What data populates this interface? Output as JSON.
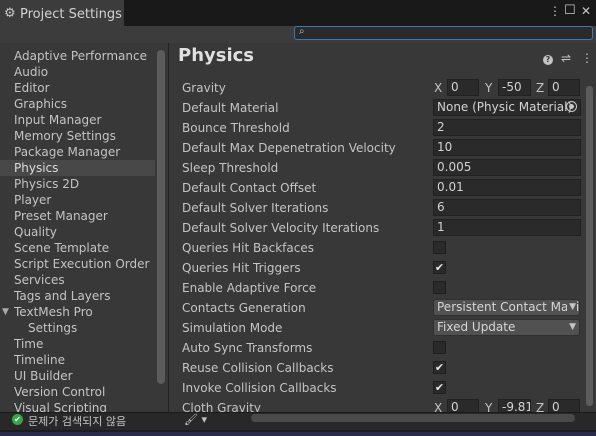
{
  "window": {
    "tab_title": "Project Settings",
    "tab_icon": "gear-icon",
    "menu_glyph": "⋮",
    "maximize_glyph": "☐",
    "close_glyph": "✕"
  },
  "search": {
    "value": "",
    "icon_glyph": "🔍"
  },
  "sidebar": {
    "items": [
      {
        "label": "Adaptive Performance"
      },
      {
        "label": "Audio"
      },
      {
        "label": "Editor"
      },
      {
        "label": "Graphics"
      },
      {
        "label": "Input Manager"
      },
      {
        "label": "Memory Settings"
      },
      {
        "label": "Package Manager"
      },
      {
        "label": "Physics",
        "selected": true
      },
      {
        "label": "Physics 2D"
      },
      {
        "label": "Player"
      },
      {
        "label": "Preset Manager"
      },
      {
        "label": "Quality"
      },
      {
        "label": "Scene Template"
      },
      {
        "label": "Script Execution Order"
      },
      {
        "label": "Services"
      },
      {
        "label": "Tags and Layers"
      },
      {
        "label": "TextMesh Pro",
        "expanded": true
      },
      {
        "label": "Settings",
        "child": true
      },
      {
        "label": "Time"
      },
      {
        "label": "Timeline"
      },
      {
        "label": "UI Builder"
      },
      {
        "label": "Version Control"
      },
      {
        "label": "Visual Scripting"
      }
    ]
  },
  "header": {
    "title": "Physics",
    "help_glyph": "?",
    "preset_glyph": "⇌",
    "menu_glyph": "⋮"
  },
  "properties": {
    "gravity": {
      "label": "Gravity",
      "x_label": "X",
      "x": "0",
      "y_label": "Y",
      "y": "-50",
      "z_label": "Z",
      "z": "0"
    },
    "default_material": {
      "label": "Default Material",
      "value": "None (Physic Material)"
    },
    "bounce_threshold": {
      "label": "Bounce Threshold",
      "value": "2"
    },
    "max_depenetration": {
      "label": "Default Max Depenetration Velocity",
      "value": "10"
    },
    "sleep_threshold": {
      "label": "Sleep Threshold",
      "value": "0.005"
    },
    "contact_offset": {
      "label": "Default Contact Offset",
      "value": "0.01"
    },
    "solver_iterations": {
      "label": "Default Solver Iterations",
      "value": "6"
    },
    "solver_velocity_iterations": {
      "label": "Default Solver Velocity Iterations",
      "value": "1"
    },
    "queries_hit_backfaces": {
      "label": "Queries Hit Backfaces",
      "checked": false
    },
    "queries_hit_triggers": {
      "label": "Queries Hit Triggers",
      "checked": true
    },
    "enable_adaptive_force": {
      "label": "Enable Adaptive Force",
      "checked": false
    },
    "contacts_generation": {
      "label": "Contacts Generation",
      "value": "Persistent Contact Manifold"
    },
    "simulation_mode": {
      "label": "Simulation Mode",
      "value": "Fixed Update"
    },
    "auto_sync_transforms": {
      "label": "Auto Sync Transforms",
      "checked": false
    },
    "reuse_collision_callbacks": {
      "label": "Reuse Collision Callbacks",
      "checked": true
    },
    "invoke_collision_callbacks": {
      "label": "Invoke Collision Callbacks",
      "checked": true
    },
    "cloth_gravity": {
      "label": "Cloth Gravity",
      "x_label": "X",
      "x": "0",
      "y_label": "Y",
      "y": "-9.81",
      "z_label": "Z",
      "z": "0"
    }
  },
  "status": {
    "message": "문제가 검색되지 않음",
    "check_glyph": "✔",
    "brush_glyph": "🖌 ▾"
  },
  "glyphs": {
    "checkmark": "✔",
    "dropdown_arrow": "▼",
    "expand_arrow": "▼"
  }
}
